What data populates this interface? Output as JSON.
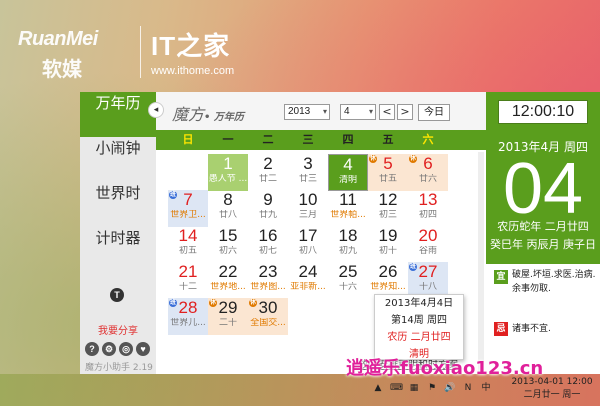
{
  "branding": {
    "logo_en": "RuanMei",
    "logo_cn": "软媒",
    "logo_it": "IT之家",
    "logo_url": "www.ithome.com"
  },
  "sidebar": {
    "items": [
      {
        "label": "万年历",
        "active": true
      },
      {
        "label": "小闹钟",
        "active": false
      },
      {
        "label": "世界时",
        "active": false
      },
      {
        "label": "计时器",
        "active": false
      }
    ],
    "share_label": "我要分享",
    "tee_icon": "T",
    "icons": [
      "?",
      "⚙",
      "◎",
      "♥"
    ],
    "version": "魔方小助手 2.19"
  },
  "toolbar": {
    "collapse_icon": "◂",
    "brand": "魔方",
    "brand_sub": "• 万年历",
    "year": "2013",
    "month": "4",
    "prev": "<",
    "next": ">",
    "today": "今日"
  },
  "weekdays": [
    "日",
    "一",
    "二",
    "三",
    "四",
    "五",
    "六"
  ],
  "calendar": {
    "rows": [
      [
        null,
        {
          "d": "1",
          "l": "愚人节 ...",
          "style": "hol"
        },
        {
          "d": "2",
          "l": "廿二"
        },
        {
          "d": "3",
          "l": "廿三"
        },
        {
          "d": "4",
          "l": "清明",
          "style": "today"
        },
        {
          "d": "5",
          "l": "廿五",
          "style": "rest",
          "badge": "休",
          "badge_color": "orange",
          "red": true
        },
        {
          "d": "6",
          "l": "廿六",
          "style": "rest",
          "badge": "休",
          "badge_color": "orange",
          "red": true
        }
      ],
      [
        {
          "d": "7",
          "l": "世界卫...",
          "style": "work",
          "badge": "班",
          "badge_color": "blue",
          "red": true,
          "orange": true
        },
        {
          "d": "8",
          "l": "廿八"
        },
        {
          "d": "9",
          "l": "廿九"
        },
        {
          "d": "10",
          "l": "三月"
        },
        {
          "d": "11",
          "l": "世界帕...",
          "orange": true
        },
        {
          "d": "12",
          "l": "初三"
        },
        {
          "d": "13",
          "l": "初四",
          "red": true
        }
      ],
      [
        {
          "d": "14",
          "l": "初五",
          "red": true
        },
        {
          "d": "15",
          "l": "初六"
        },
        {
          "d": "16",
          "l": "初七"
        },
        {
          "d": "17",
          "l": "初八"
        },
        {
          "d": "18",
          "l": "初九"
        },
        {
          "d": "19",
          "l": "初十"
        },
        {
          "d": "20",
          "l": "谷雨",
          "red": true
        }
      ],
      [
        {
          "d": "21",
          "l": "十二",
          "red": true
        },
        {
          "d": "22",
          "l": "世界地...",
          "orange": true
        },
        {
          "d": "23",
          "l": "世界图...",
          "orange": true
        },
        {
          "d": "24",
          "l": "亚非新...",
          "orange": true
        },
        {
          "d": "25",
          "l": "十六"
        },
        {
          "d": "26",
          "l": "世界知...",
          "orange": true
        },
        {
          "d": "27",
          "l": "十八",
          "style": "work",
          "badge": "班",
          "badge_color": "blue",
          "red": true
        }
      ],
      [
        {
          "d": "28",
          "l": "世界儿...",
          "style": "work",
          "badge": "班",
          "badge_color": "blue",
          "red": true
        },
        {
          "d": "29",
          "l": "二十",
          "style": "rest",
          "badge": "休",
          "badge_color": "orange"
        },
        {
          "d": "30",
          "l": "全国交...",
          "style": "rest",
          "badge": "休",
          "badge_color": "orange",
          "orange": true
        },
        null,
        null,
        null,
        null
      ]
    ]
  },
  "popup": {
    "date": "2013年4月4日",
    "week": "第14周  周四",
    "lunar": "农历 二月廿四",
    "term": "清明"
  },
  "bottom_link": "放假安排声明和时方案",
  "right_panel": {
    "clock": "12:00:10",
    "year_month": "2013年4月  周四",
    "day": "04",
    "lunar1": "农历蛇年  二月廿四",
    "lunar2": "癸巳年 丙辰月 庚子日",
    "yi_label": "宜",
    "yi_text": "破屋.坏垣.求医.治病.余事勿取.",
    "ji_label": "忌",
    "ji_text": "诸事不宜."
  },
  "taskbar": {
    "tray_icons": [
      "▲",
      "⌨",
      "▦",
      "⚑",
      "🔊",
      "N",
      "中"
    ],
    "time": "2013-04-01  12:00",
    "date": "二月廿一  周一"
  },
  "watermark": "逍遥乐fuoxiao123.cn",
  "colors": {
    "accent": "#5a9e1d",
    "red": "#e02020",
    "orange": "#e07a00",
    "work": "#dde6f4",
    "rest": "#fbe6d2"
  }
}
